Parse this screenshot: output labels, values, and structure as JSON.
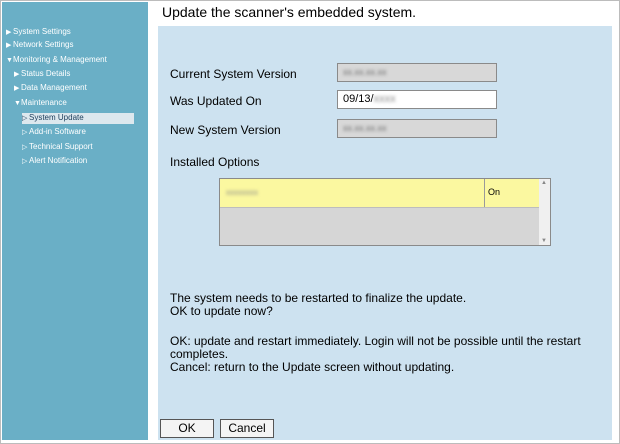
{
  "sidebar": {
    "items": [
      {
        "label": "System Settings",
        "marker": "▶"
      },
      {
        "label": "Network Settings",
        "marker": "▶"
      },
      {
        "label": "Monitoring & Management",
        "marker": "▼"
      },
      {
        "label": "Status Details",
        "marker": "▶"
      },
      {
        "label": "Data Management",
        "marker": "▶"
      },
      {
        "label": "Maintenance",
        "marker": "▼"
      },
      {
        "label": "System Update",
        "marker": "▷",
        "selected": true
      },
      {
        "label": "Add-in Software",
        "marker": "▷"
      },
      {
        "label": "Technical Support",
        "marker": "▷"
      },
      {
        "label": "Alert Notification",
        "marker": "▷"
      }
    ]
  },
  "page": {
    "title": "Update the scanner's embedded system."
  },
  "form": {
    "current_label": "Current System Version",
    "current_value": "xx.xx.xx.xx",
    "updated_label": "Was Updated On",
    "updated_value": "09/13/",
    "updated_year_blur": "xxxx",
    "new_label": "New System Version",
    "new_value": "xx.xx.xx.xx"
  },
  "options": {
    "label": "Installed Options",
    "rows": [
      {
        "name": "xxxxxxxx",
        "status": "On"
      }
    ]
  },
  "messages": {
    "line1": "The system needs to be restarted to finalize the update.",
    "line2": "OK to update now?",
    "line3": "OK: update and restart immediately. Login will not be possible until the restart",
    "line4": "completes.",
    "line5": "Cancel: return to the Update screen without updating."
  },
  "buttons": {
    "ok": "OK",
    "cancel": "Cancel"
  },
  "colors": {
    "sidebar_bg": "#6aafc6",
    "content_bg": "#cde2f0",
    "selected_row": "#fbf8a0",
    "selected_nav": "#dde8ee"
  }
}
